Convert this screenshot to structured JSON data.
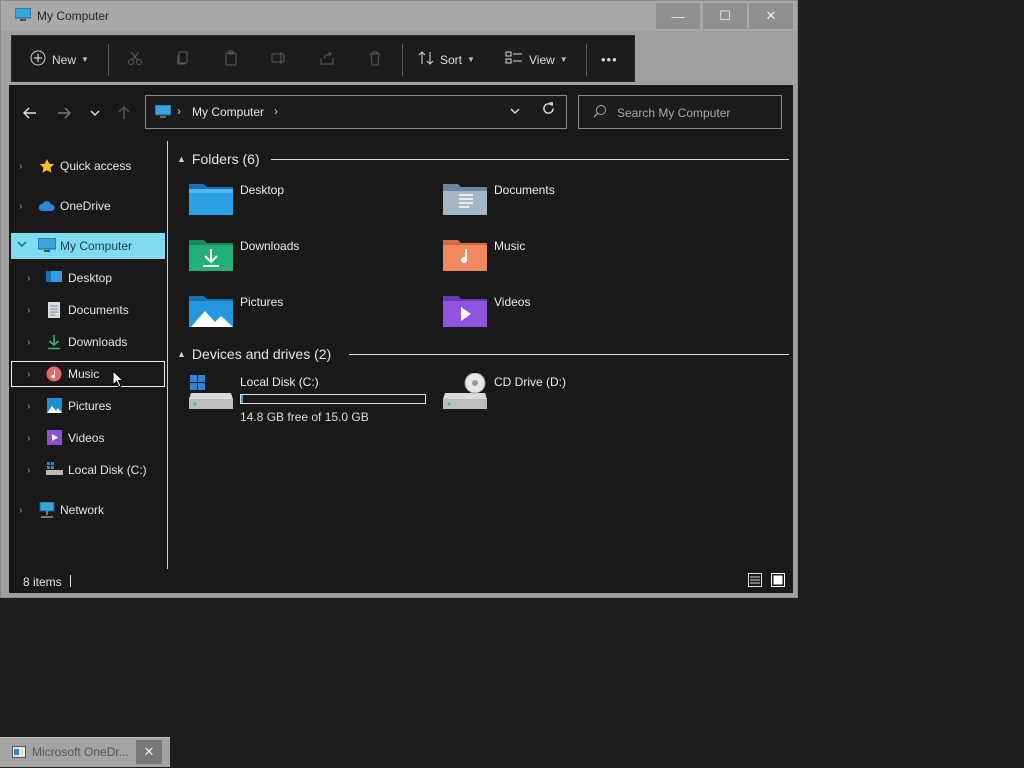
{
  "window": {
    "title": "My Computer"
  },
  "controls": {
    "minimize": "—",
    "maximize": "☐",
    "close": "✕"
  },
  "toolbar": {
    "new_label": "New",
    "sort_label": "Sort",
    "view_label": "View",
    "more_label": "•••"
  },
  "address": {
    "crumb": "My Computer"
  },
  "search": {
    "placeholder": "Search My Computer"
  },
  "sidebar": {
    "items": [
      {
        "label": "Quick access"
      },
      {
        "label": "OneDrive"
      },
      {
        "label": "My Computer"
      },
      {
        "label": "Desktop"
      },
      {
        "label": "Documents"
      },
      {
        "label": "Downloads"
      },
      {
        "label": "Music"
      },
      {
        "label": "Pictures"
      },
      {
        "label": "Videos"
      },
      {
        "label": "Local Disk (C:)"
      },
      {
        "label": "Network"
      }
    ]
  },
  "content": {
    "folders_header": "Folders (6)",
    "folders": [
      {
        "label": "Desktop"
      },
      {
        "label": "Documents"
      },
      {
        "label": "Downloads"
      },
      {
        "label": "Music"
      },
      {
        "label": "Pictures"
      },
      {
        "label": "Videos"
      }
    ],
    "drives_header": "Devices and drives (2)",
    "drives": [
      {
        "label": "Local Disk (C:)",
        "free_text": "14.8 GB free of 15.0 GB",
        "used_fraction": 0.013
      },
      {
        "label": "CD Drive (D:)"
      }
    ]
  },
  "status": {
    "count": "8 items"
  },
  "taskbar": {
    "item_label": "Microsoft OneDr...",
    "close": "✕"
  },
  "colors": {
    "selection": "#7fdcf0",
    "usage_bar": "#26a0da",
    "background": "#191919"
  }
}
